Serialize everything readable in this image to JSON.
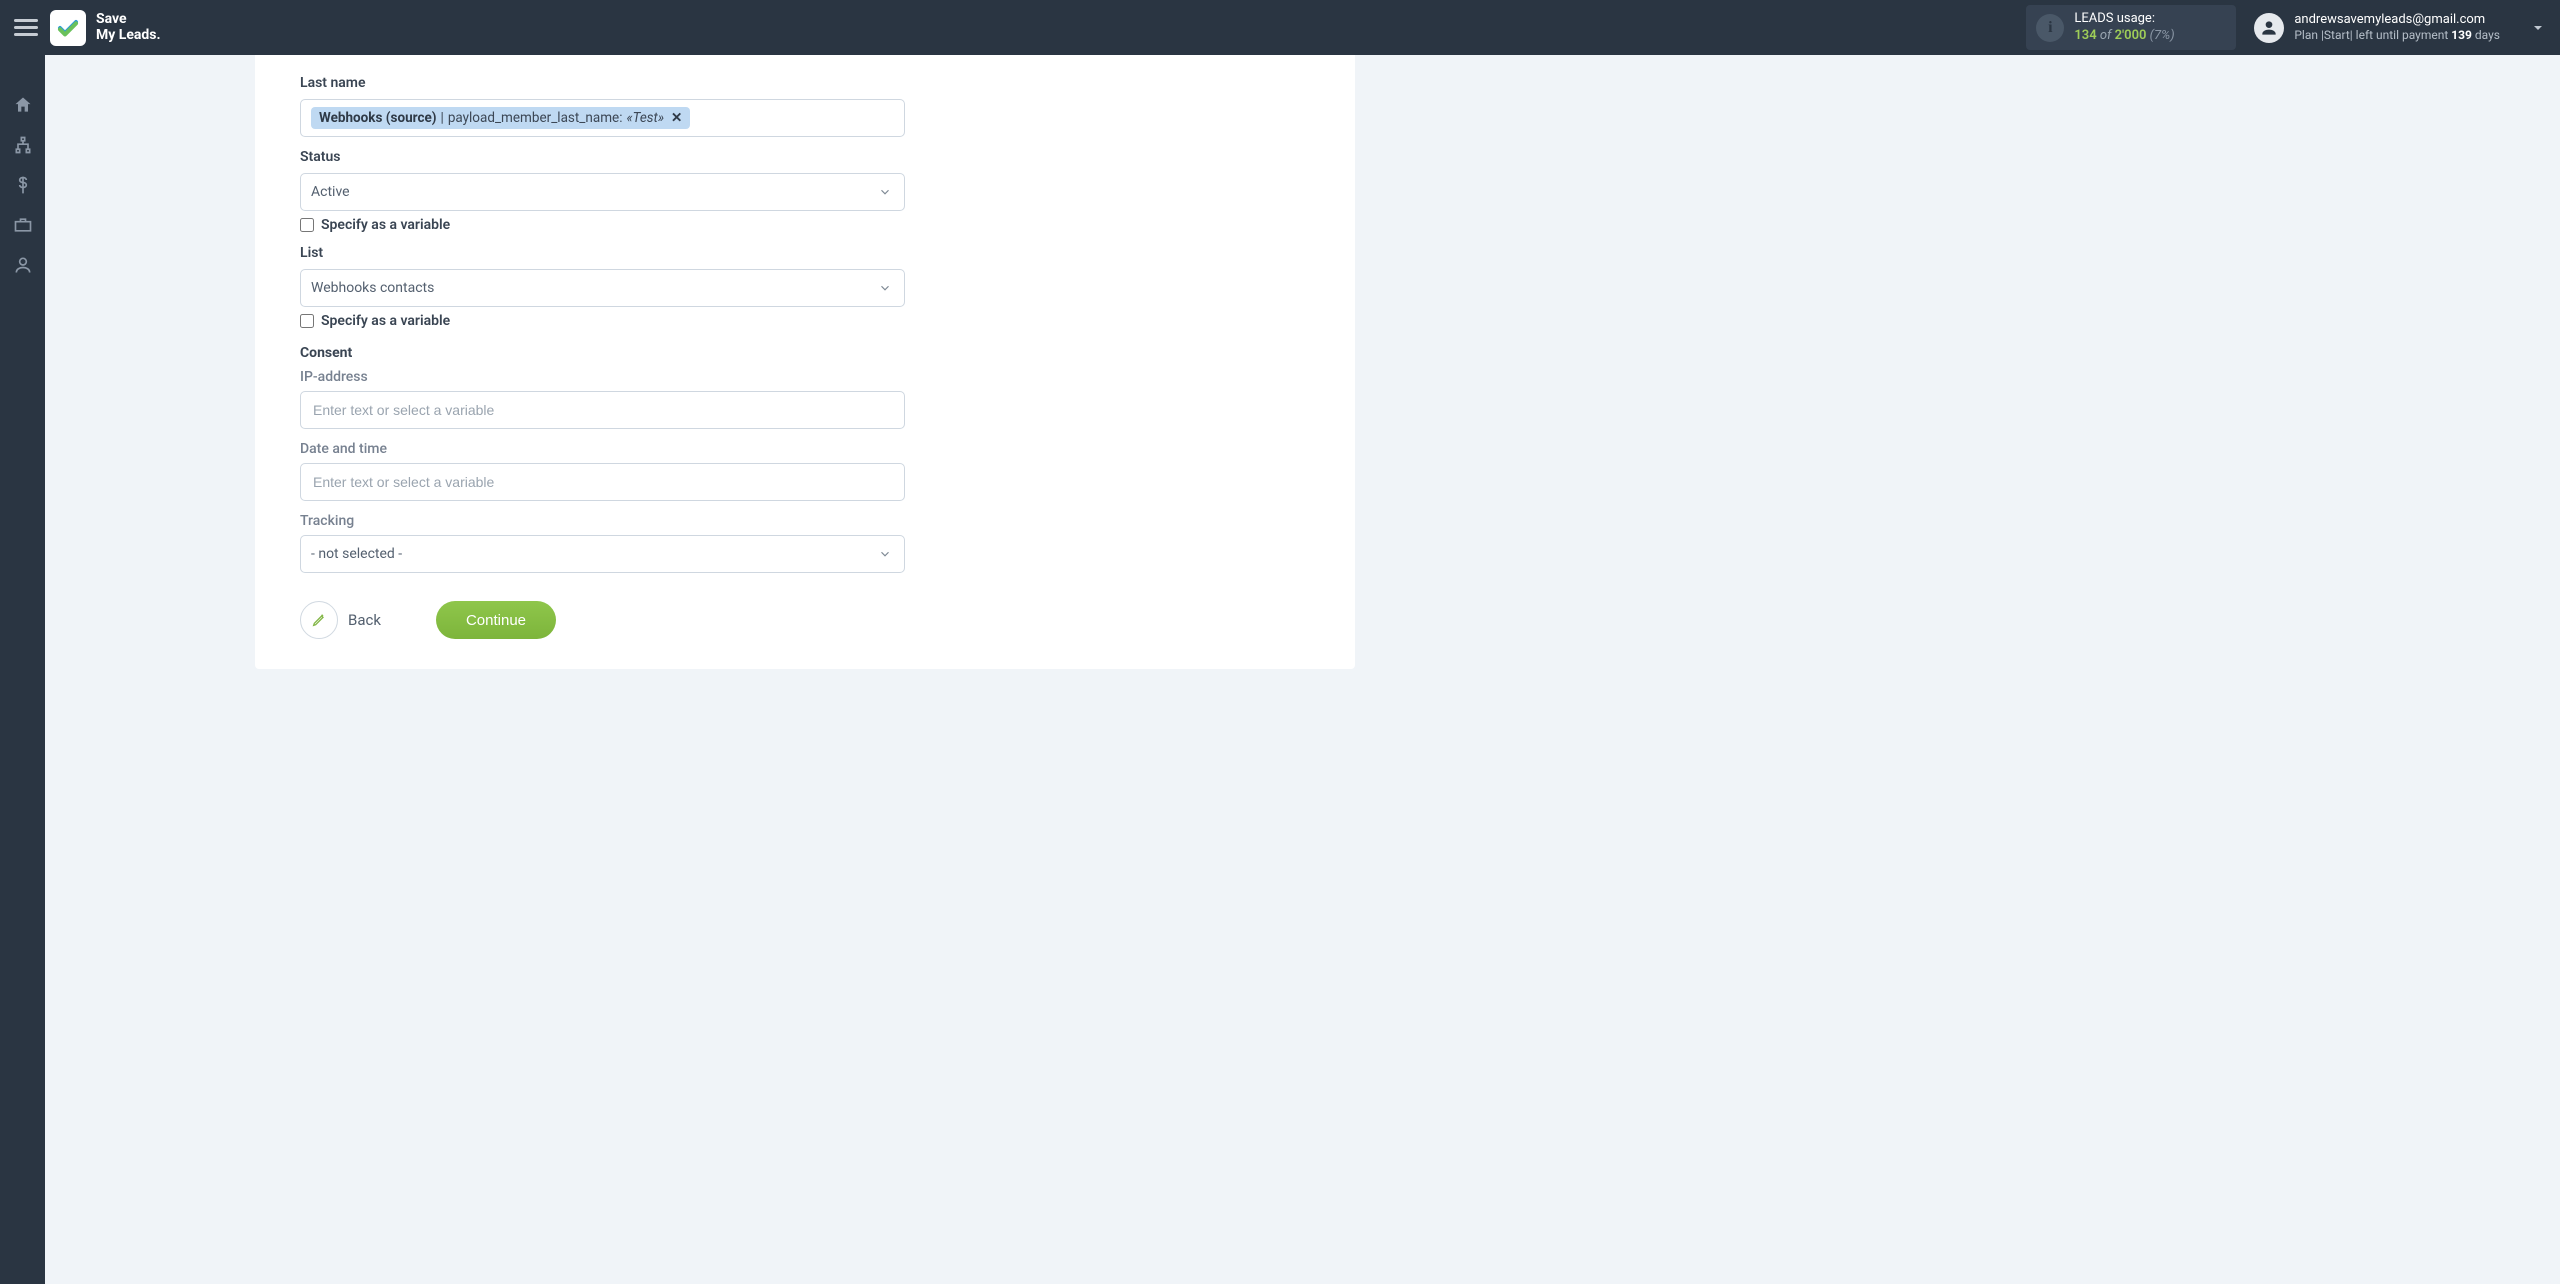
{
  "app": {
    "name_line1": "Save",
    "name_line2": "My Leads."
  },
  "header": {
    "usage": {
      "label": "LEADS usage:",
      "used": "134",
      "of": "of",
      "total": "2'000",
      "percent": "(7%)"
    },
    "account": {
      "email": "andrewsavemyleads@gmail.com",
      "plan_prefix": "Plan |Start| left until payment ",
      "days_number": "139",
      "days_suffix": " days"
    }
  },
  "sidebar": {
    "items": [
      {
        "name": "home"
      },
      {
        "name": "integrations"
      },
      {
        "name": "billing"
      },
      {
        "name": "workspace"
      },
      {
        "name": "account"
      }
    ]
  },
  "form": {
    "last_name": {
      "label": "Last name",
      "tag_source": "Webhooks (source)",
      "tag_separator": "|",
      "tag_key": "payload_member_last_name:",
      "tag_value": "«Test»"
    },
    "status": {
      "label": "Status",
      "value": "Active",
      "specify_label": "Specify as a variable",
      "specify_checked": false
    },
    "list": {
      "label": "List",
      "value": "Webhooks contacts",
      "specify_label": "Specify as a variable",
      "specify_checked": false
    },
    "consent": {
      "heading": "Consent",
      "ip": {
        "label": "IP-address",
        "placeholder": "Enter text or select a variable"
      },
      "datetime": {
        "label": "Date and time",
        "placeholder": "Enter text or select a variable"
      },
      "tracking": {
        "label": "Tracking",
        "value": "- not selected -"
      }
    },
    "actions": {
      "back": "Back",
      "continue": "Continue"
    }
  }
}
